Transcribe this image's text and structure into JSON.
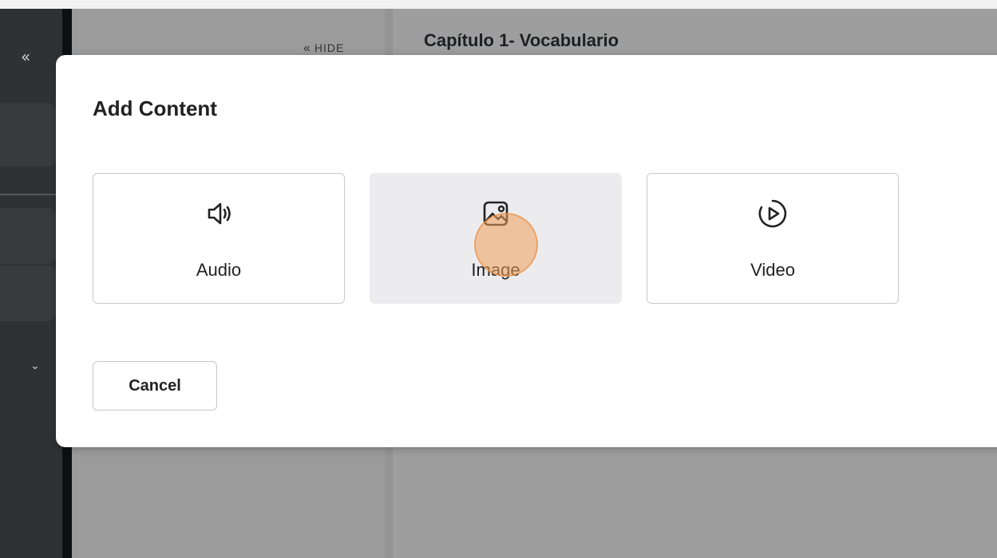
{
  "sidebar": {
    "collapse_glyph": "«",
    "chevron_glyph": "⌄"
  },
  "panel": {
    "hide_label": "HIDE",
    "hide_glyph": "«"
  },
  "main": {
    "chapter_title": "Capítulo 1- Vocabulario"
  },
  "modal": {
    "title": "Add Content",
    "options": [
      {
        "label": "Audio",
        "icon": "speaker-icon"
      },
      {
        "label": "Image",
        "icon": "image-icon",
        "selected": true
      },
      {
        "label": "Video",
        "icon": "play-circle-icon"
      }
    ],
    "cancel_label": "Cancel"
  },
  "colors": {
    "modal_bg": "#ffffff",
    "overlay": "#9e9e9e",
    "selected_option_bg": "#ececef",
    "click_indicator": "#f0a05a"
  }
}
